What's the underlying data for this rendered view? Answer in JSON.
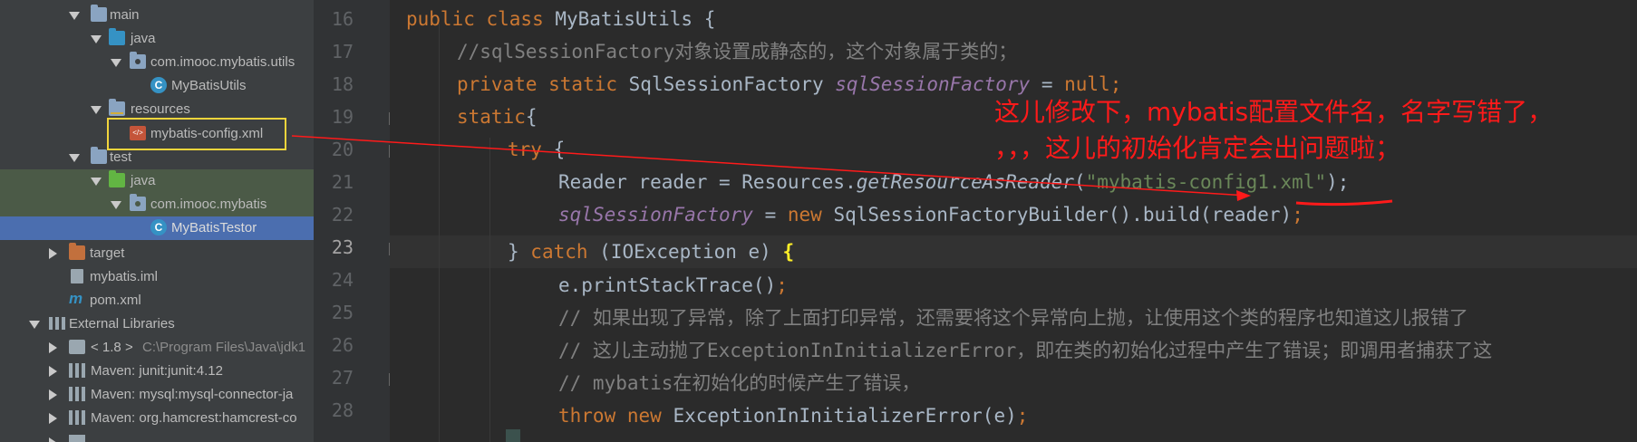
{
  "project_tree": {
    "items": [
      {
        "label": "main",
        "type": "folder"
      },
      {
        "label": "java",
        "type": "folder-src"
      },
      {
        "label": "com.imooc.mybatis.utils",
        "type": "package"
      },
      {
        "label": "MyBatisUtils",
        "type": "class"
      },
      {
        "label": "resources",
        "type": "folder-res"
      },
      {
        "label": "mybatis-config.xml",
        "type": "xml"
      },
      {
        "label": "test",
        "type": "folder"
      },
      {
        "label": "java",
        "type": "folder-test"
      },
      {
        "label": "com.imooc.mybatis",
        "type": "package"
      },
      {
        "label": "MyBatisTestor",
        "type": "class"
      },
      {
        "label": "target",
        "type": "folder-excluded"
      },
      {
        "label": "mybatis.iml",
        "type": "iml"
      },
      {
        "label": "pom.xml",
        "type": "maven"
      },
      {
        "label": "External Libraries",
        "type": "libraries"
      },
      {
        "label": "< 1.8 >",
        "sub": "C:\\Program Files\\Java\\jdk1",
        "type": "jdk"
      },
      {
        "label": "Maven: junit:junit:4.12",
        "type": "lib"
      },
      {
        "label": "Maven: mysql:mysql-connector-ja",
        "type": "lib"
      },
      {
        "label": "Maven: org.hamcrest:hamcrest-co",
        "type": "lib"
      }
    ]
  },
  "editor": {
    "line_numbers": [
      "16",
      "17",
      "18",
      "19",
      "20",
      "21",
      "22",
      "23",
      "24",
      "25",
      "26",
      "27",
      "28"
    ],
    "current_line": "23",
    "code": {
      "l16_kw1": "public class",
      "l16_rest": " MyBatisUtils {",
      "l17": "//sqlSessionFactory对象设置成静态的，这个对象属于类的；",
      "l18_kw": "private static",
      "l18_type": " SqlSessionFactory ",
      "l18_field": "sqlSessionFactory",
      "l18_eq": " = ",
      "l18_null": "null",
      "l18_semi": ";",
      "l19_kw": "static",
      "l19_rest": "{",
      "l20_kw": "try",
      "l20_rest": " {",
      "l21_a": "Reader reader = Resources.",
      "l21_method": "getResourceAsReader",
      "l21_p": "(",
      "l21_str": "\"mybatis-config1.xml\"",
      "l21_end": ");",
      "l22_field": "sqlSessionFactory",
      "l22_eq": " = ",
      "l22_new": "new",
      "l22_rest": " SqlSessionFactoryBuilder().build(reader)",
      "l22_semi": ";",
      "l23_a": "} ",
      "l23_catch": "catch",
      "l23_b": " (IOException e) ",
      "l23_brace": "{",
      "l24": "e.printStackTrace()",
      "l24_semi": ";",
      "l25": "// 如果出现了异常，除了上面打印异常，还需要将这个异常向上抛，让使用这个类的程序也知道这儿报错了",
      "l26": "// 这儿主动抛了ExceptionInInitializerError，即在类的初始化过程中产生了错误；即调用者捕获了这",
      "l27": "// mybatis在初始化的时候产生了错误，",
      "l28_throw": "throw new",
      "l28_rest": " ExceptionInInitializerError(e)",
      "l28_semi": ";"
    }
  },
  "annotation": {
    "line1": "这儿修改下，mybatis配置文件名，名字写错了，",
    "line2": "，，，这儿的初始化肯定会出问题啦；",
    "color": "#ff1a1a"
  },
  "colors": {
    "panel_bg": "#3c3f41",
    "editor_bg": "#2b2b2b",
    "gutter_bg": "#313335",
    "selected_row": "#4b6eaf",
    "keyword": "#cc7832",
    "string": "#6a8759",
    "field": "#9876aa",
    "comment": "#808080",
    "highlight_box": "#f2d53c"
  }
}
